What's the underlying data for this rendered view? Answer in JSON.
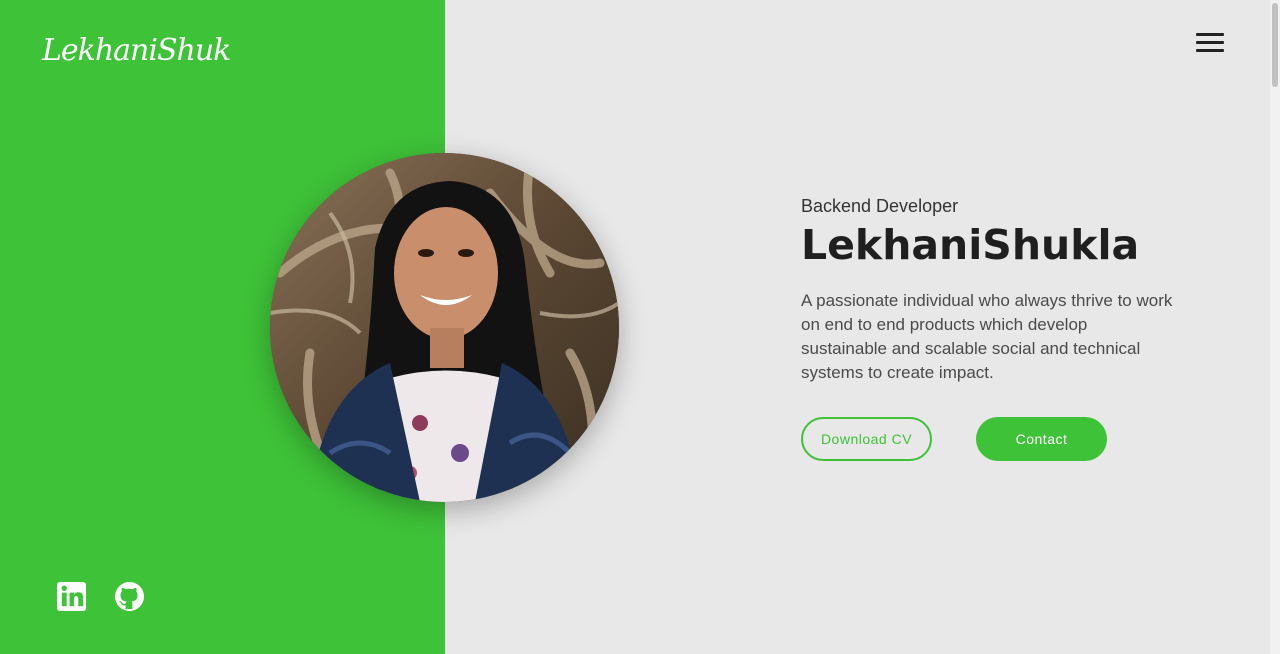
{
  "brand": {
    "logo_text": "LekhaniShukla",
    "accent_color": "#3ec238"
  },
  "nav": {
    "menu_icon": "hamburger-menu-icon"
  },
  "hero": {
    "role": "Backend Developer",
    "name": "LekhaniShukla",
    "description": "A passionate individual who always thrive to work on end to end products which develop sustainable and scalable social and technical systems to create impact.",
    "buttons": {
      "download_cv": "Download CV",
      "contact": "Contact"
    }
  },
  "portrait": {
    "icon": "profile-photo"
  },
  "social": {
    "linkedin_icon": "linkedin-icon",
    "github_icon": "github-icon"
  }
}
